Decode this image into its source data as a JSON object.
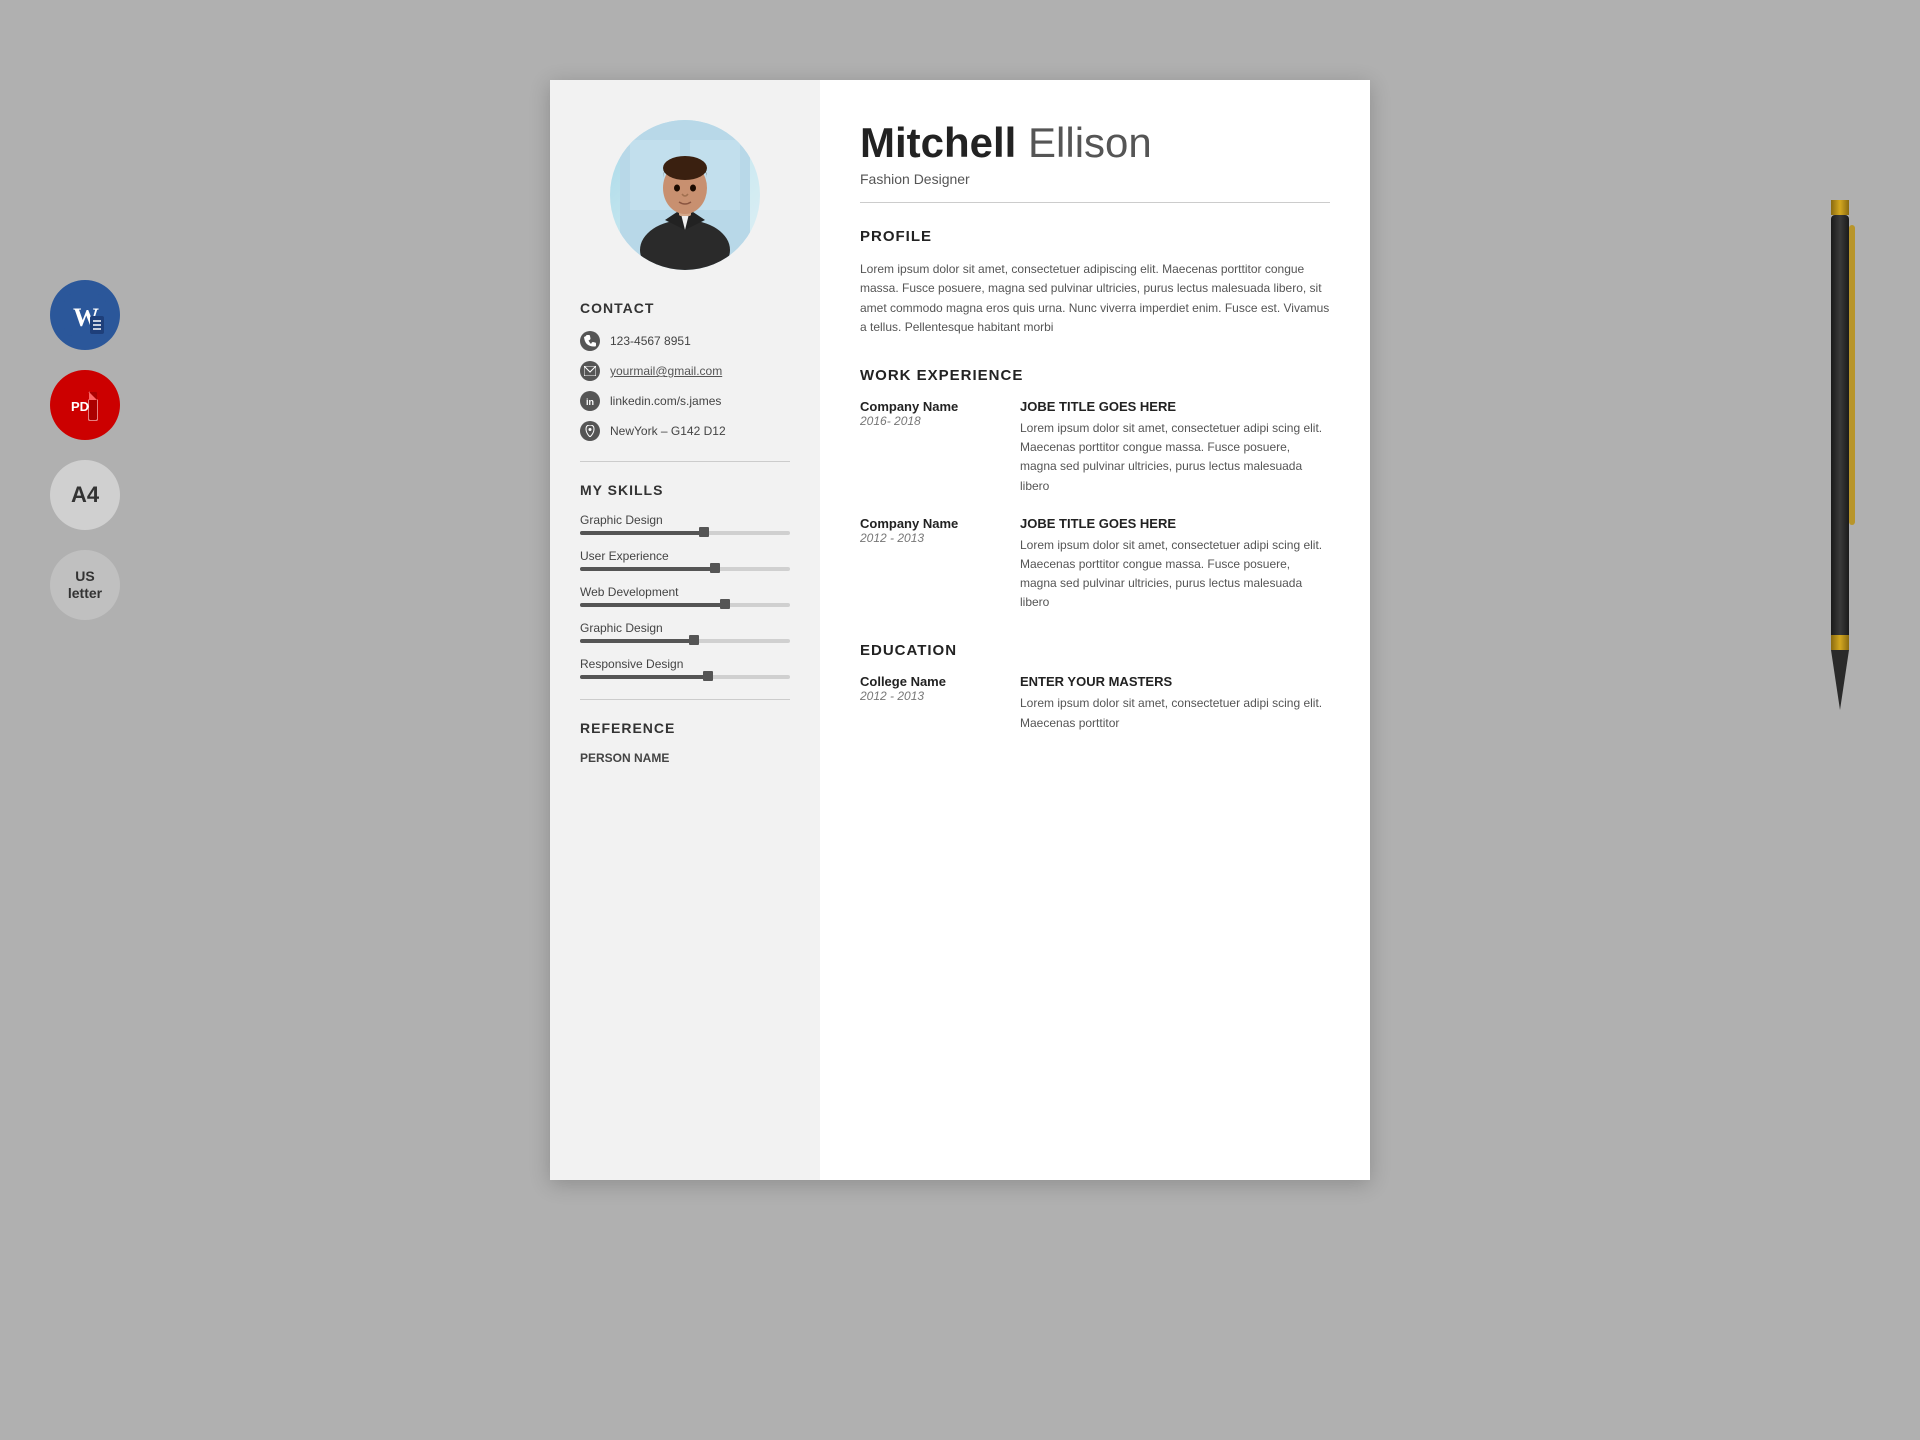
{
  "icons": {
    "word_label": "W",
    "pdf_label": "PDF",
    "a4_label": "A4",
    "us_label": "US\nletter"
  },
  "resume": {
    "person": {
      "first_name": "Mitchell",
      "last_name": "Ellison",
      "title": "Fashion Designer"
    },
    "contact": {
      "section_title": "CONTACT",
      "phone": "123-4567 8951",
      "email": "yourmail@gmail.com",
      "linkedin": "linkedin.com/s.james",
      "location": "NewYork – G142 D12"
    },
    "skills": {
      "section_title": "MY SKILLS",
      "items": [
        {
          "name": "Graphic Design",
          "percent": 60
        },
        {
          "name": "User Experience",
          "percent": 65
        },
        {
          "name": "Web Development",
          "percent": 70
        },
        {
          "name": "Graphic Design",
          "percent": 55
        },
        {
          "name": "Responsive Design",
          "percent": 62
        }
      ]
    },
    "reference": {
      "section_title": "REFERENCE",
      "person_label": "PERSON NAME"
    },
    "profile": {
      "section_title": "PROFILE",
      "text": "Lorem ipsum dolor sit amet, consectetuer adipiscing elit. Maecenas porttitor congue massa. Fusce posuere, magna sed pulvinar ultricies, purus lectus malesuada libero, sit amet commodo magna eros quis urna. Nunc viverra imperdiet enim. Fusce est. Vivamus a tellus. Pellentesque habitant morbi"
    },
    "work_experience": {
      "section_title": "WORK EXPERIENCE",
      "entries": [
        {
          "company": "Company Name",
          "dates": "2016- 2018",
          "job_title": "JOBE TITLE GOES HERE",
          "description": "Lorem ipsum dolor sit amet, consectetuer adipi scing elit. Maecenas porttitor congue massa. Fusce posuere, magna sed pulvinar ultricies, purus lectus malesuada libero"
        },
        {
          "company": "Company Name",
          "dates": "2012 - 2013",
          "job_title": "JOBE TITLE GOES HERE",
          "description": "Lorem ipsum dolor sit amet, consectetuer adipi scing elit. Maecenas porttitor congue massa. Fusce posuere, magna sed pulvinar ultricies, purus lectus malesuada libero"
        }
      ]
    },
    "education": {
      "section_title": "EDUCATION",
      "entries": [
        {
          "college": "College Name",
          "dates": "2012 - 2013",
          "degree": "ENTER YOUR MASTERS",
          "description": "Lorem ipsum dolor sit amet, consectetuer adipi scing elit. Maecenas porttitor"
        }
      ]
    }
  }
}
